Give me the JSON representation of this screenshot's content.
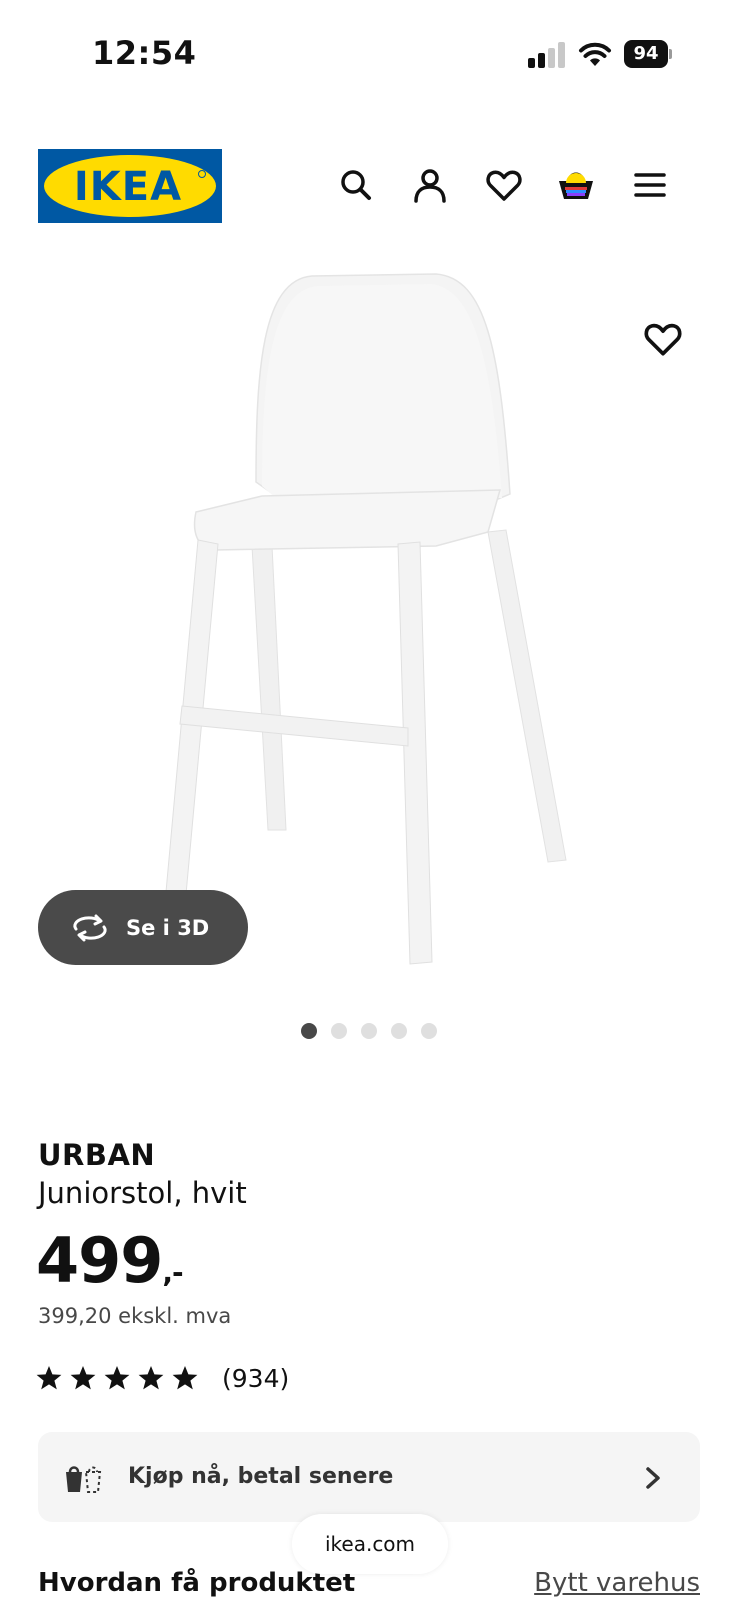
{
  "status_bar": {
    "time": "12:54",
    "battery": "94"
  },
  "header": {
    "logo_text": "IKEA",
    "icons": [
      "search-icon",
      "account-icon",
      "heart-icon",
      "cart-icon",
      "menu-icon"
    ]
  },
  "gallery": {
    "view_3d_label": "Se i 3D",
    "slide_count": 5,
    "active_slide": 1
  },
  "product": {
    "name": "URBAN",
    "description": "Juniorstol, hvit",
    "price": "499",
    "price_suffix": ",-",
    "price_excl_vat": "399,20 ekskl. mva",
    "rating_stars": 5,
    "rating_count": "(934)"
  },
  "payment": {
    "label": "Kjøp nå, betal senere"
  },
  "delivery": {
    "title": "Hvordan få produktet",
    "change_store_label": "Bytt varehus"
  },
  "browser": {
    "url": "ikea.com"
  },
  "colors": {
    "ikea_blue": "#0058a3",
    "ikea_yellow": "#ffdb00",
    "button_dark": "#4a4a4a"
  }
}
